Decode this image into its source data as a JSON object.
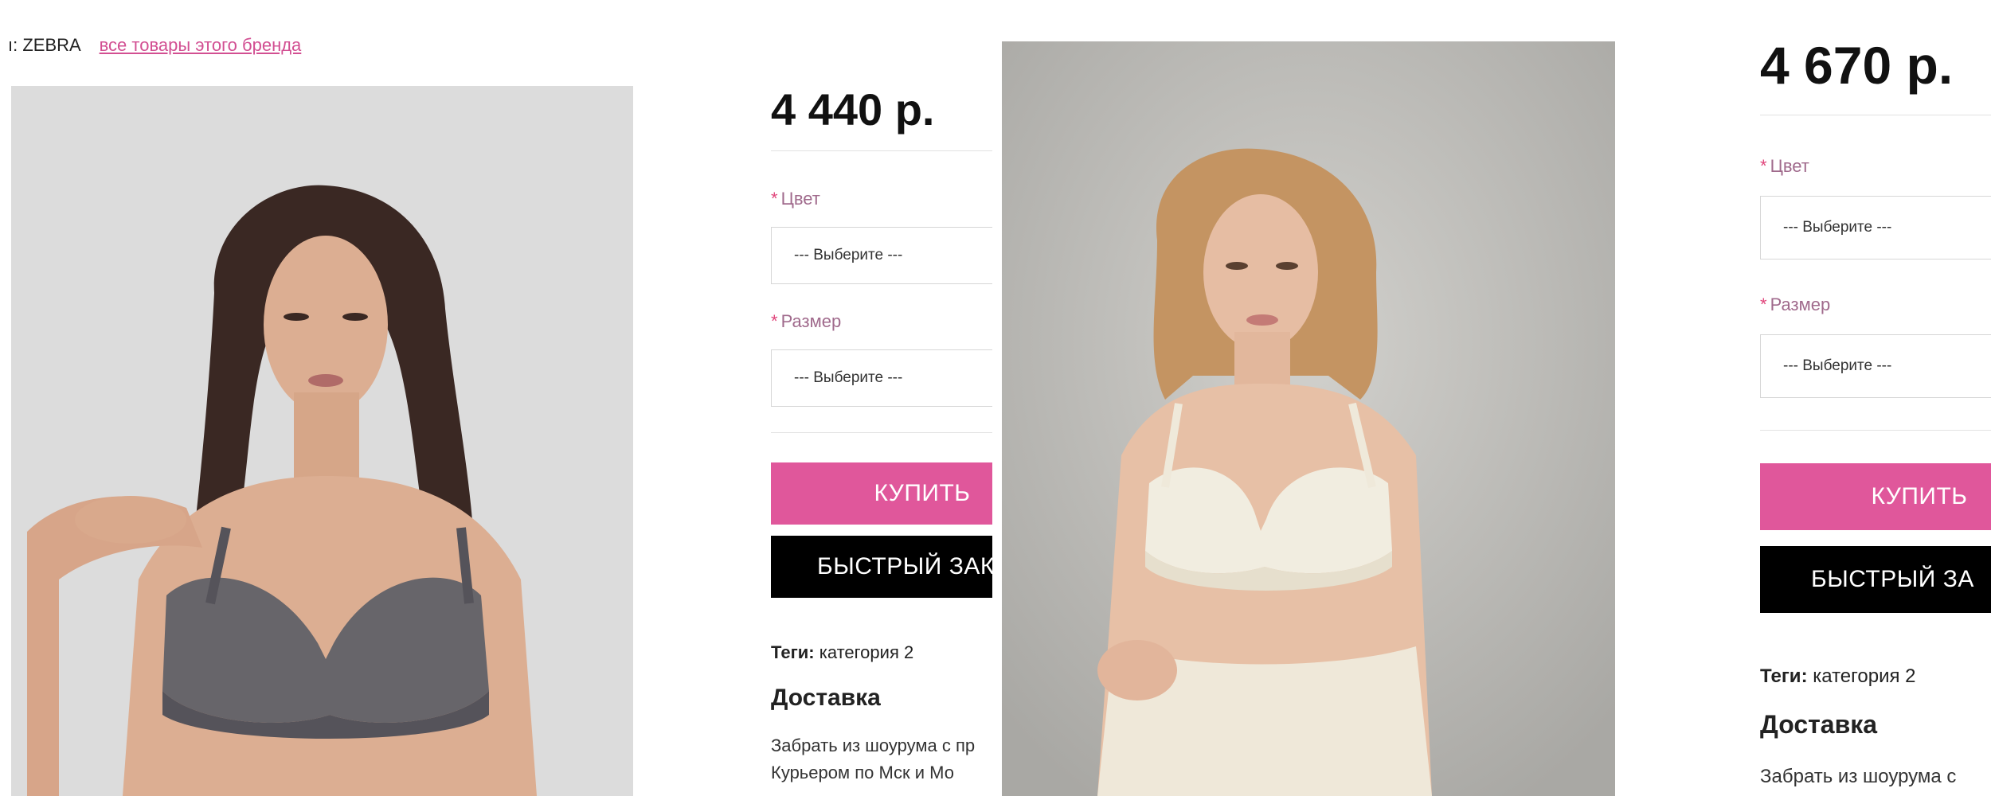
{
  "left_panel": {
    "brand_prefix": "ı: ZEBRA",
    "brand_link": "все товары этого бренда",
    "price": "4 440 р.",
    "color_label": "Цвет",
    "color_select": "--- Выберите ---",
    "size_label": "Размер",
    "size_select": "--- Выберите ---",
    "buy_label": "КУПИТЬ",
    "quick_order_label": "БЫСТРЫЙ ЗАКА",
    "tags_label": "Теги:",
    "tags_value": "категория 2",
    "delivery_heading": "Доставка",
    "delivery_line1": "Забрать из шоурума с пр",
    "delivery_line2": "Курьером по Мск и Мо"
  },
  "right_panel": {
    "price": "4 670 р.",
    "color_label": "Цвет",
    "color_select": "--- Выберите ---",
    "size_label": "Размер",
    "size_select": "--- Выберите ---",
    "buy_label": "КУПИТЬ",
    "quick_order_label": "БЫСТРЫЙ ЗА",
    "tags_label": "Теги:",
    "tags_value": "категория 2",
    "delivery_heading": "Доставка",
    "delivery_line1": "Забрать из шоурума с"
  },
  "colors": {
    "accent_pink": "#e0579b",
    "link_pink": "#d24f92",
    "required_star": "#e0457b",
    "quick_order_bg": "#000000"
  }
}
